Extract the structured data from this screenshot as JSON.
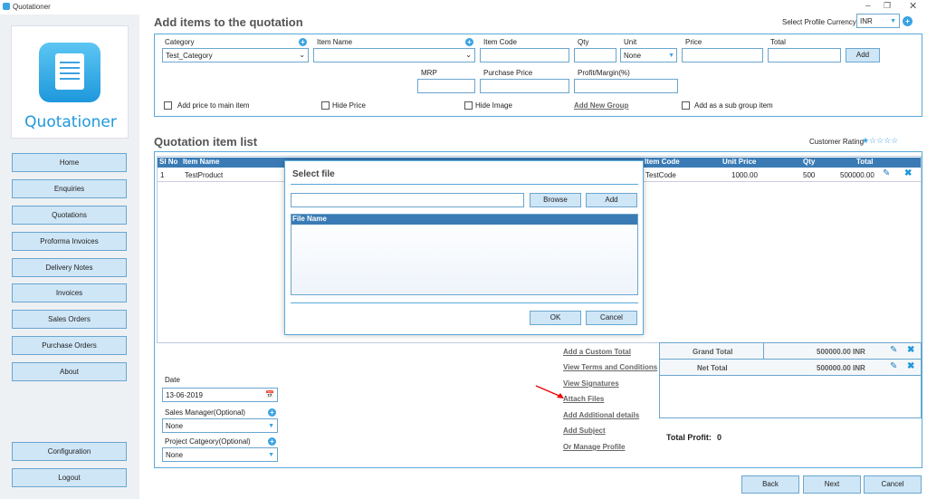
{
  "window": {
    "title": "Quotationer"
  },
  "logo": {
    "text": "Quotationer"
  },
  "nav": [
    "Home",
    "Enquiries",
    "Quotations",
    "Proforma Invoices",
    "Delivery Notes",
    "Invoices",
    "Sales Orders",
    "Purchase Orders",
    "About"
  ],
  "nav_bottom": [
    "Configuration",
    "Logout"
  ],
  "header": {
    "title": "Add items to the quotation",
    "currency_label": "Select Profile Currency",
    "currency_value": "INR"
  },
  "form": {
    "category_label": "Category",
    "category_value": "Test_Category",
    "item_name_label": "Item Name",
    "item_code_label": "Item Code",
    "qty_label": "Qty",
    "unit_label": "Unit",
    "unit_value": "None",
    "price_label": "Price",
    "total_label": "Total",
    "add_btn": "Add",
    "mrp_label": "MRP",
    "purchase_label": "Purchase Price",
    "profit_label": "Profit/Margin(%)",
    "opt1": "Add price to main item",
    "opt2": "Hide Price",
    "opt3": "Hide Image",
    "new_group": "Add New Group",
    "opt4": "Add as a sub group item"
  },
  "list": {
    "title": "Quotation item list",
    "rating_label": "Customer Rating",
    "rating_stars": "★☆☆☆☆",
    "headers": [
      "Sl No",
      "Item Name",
      "Item Code",
      "Unit Price",
      "Qty",
      "Total"
    ],
    "row": [
      "1",
      "TestProduct",
      "TestCode",
      "1000.00",
      "500",
      "500000.00"
    ]
  },
  "dialog": {
    "title": "Select file",
    "browse": "Browse",
    "add": "Add",
    "col": "File Name",
    "ok": "OK",
    "cancel": "Cancel"
  },
  "bottom": {
    "date_label": "Date",
    "date_value": "13-06-2019",
    "sm_label": "Sales Manager(Optional)",
    "sm_value": "None",
    "pc_label": "Project Catgeory(Optional)",
    "pc_value": "None"
  },
  "links": [
    "Add a Custom Total",
    "View Terms and Conditions",
    "View Signatures",
    "Attach Files",
    "Add Additional details",
    "Add Subject",
    "Or Manage Profile"
  ],
  "totals": {
    "grand_label": "Grand Total",
    "grand_value": "500000.00",
    "grand_cur": "INR",
    "net_label": "Net Total",
    "net_value": "500000.00",
    "net_cur": "INR",
    "profit_label": "Total Profit:",
    "profit_value": "0"
  },
  "footer": {
    "back": "Back",
    "next": "Next",
    "cancel": "Cancel"
  }
}
